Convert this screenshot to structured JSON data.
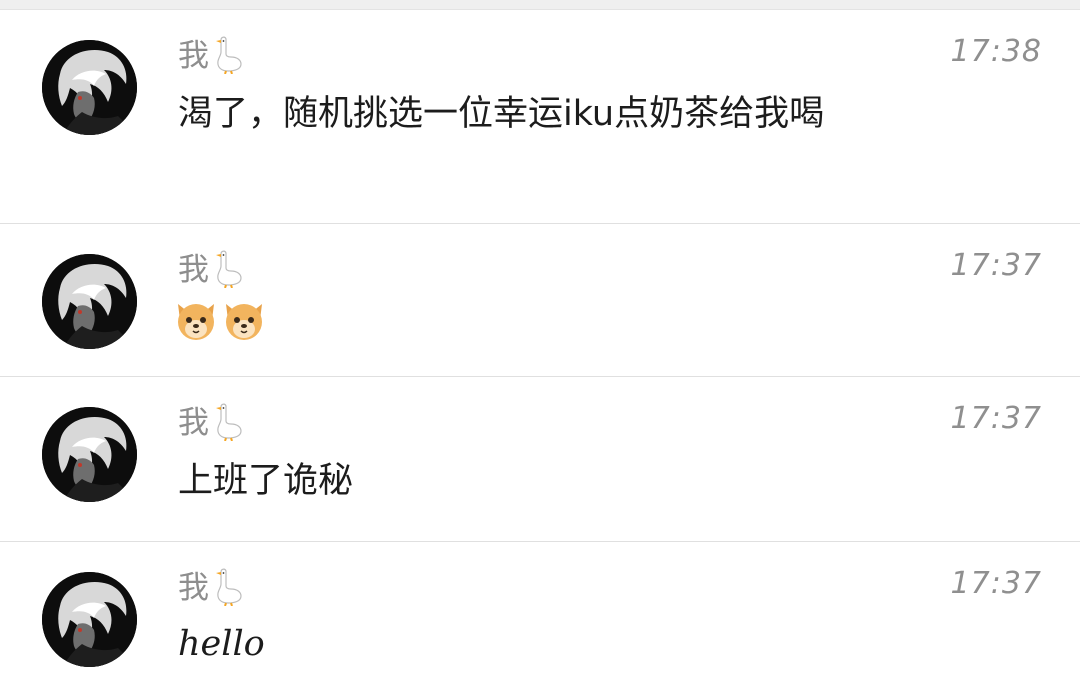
{
  "messages": [
    {
      "sender": "我",
      "sender_icon": "goose-icon",
      "time": "17:38",
      "text": "渴了，随机挑选一位幸运iku点奶茶给我喝"
    },
    {
      "sender": "我",
      "sender_icon": "goose-icon",
      "time": "17:37",
      "content_icons": [
        "dog-face-icon",
        "dog-face-icon"
      ]
    },
    {
      "sender": "我",
      "sender_icon": "goose-icon",
      "time": "17:37",
      "text": "上班了诡秘"
    },
    {
      "sender": "我",
      "sender_icon": "goose-icon",
      "time": "17:37",
      "text": "hello"
    }
  ],
  "colors": {
    "sender_text": "#8e8e8e",
    "time_text": "#8f8f8f",
    "message_text": "#1c1c1c",
    "divider": "#e0e0e0",
    "avatar_bg": "#0d0d0d"
  }
}
